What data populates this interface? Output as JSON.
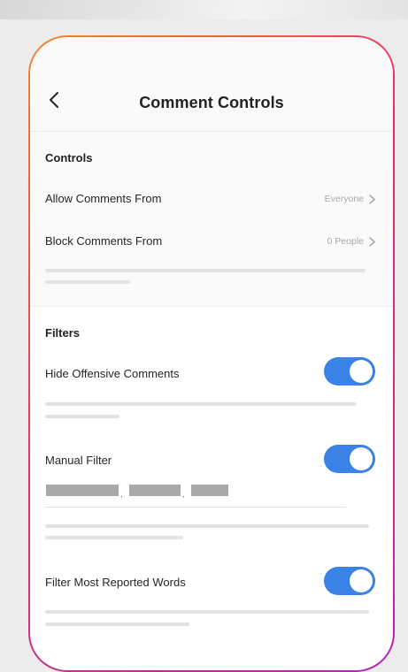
{
  "header": {
    "title": "Comment Controls",
    "back_icon": "chevron-left-icon"
  },
  "controls": {
    "section_title": "Controls",
    "rows": [
      {
        "label": "Allow Comments From",
        "value": "Everyone"
      },
      {
        "label": "Block Comments From",
        "value": "0 People"
      }
    ]
  },
  "filters": {
    "section_title": "Filters",
    "items": [
      {
        "label": "Hide Offensive Comments",
        "enabled": true
      },
      {
        "label": "Manual Filter",
        "enabled": true
      },
      {
        "label": "Filter Most Reported Words",
        "enabled": true
      }
    ],
    "manual_filter_separator": ","
  },
  "colors": {
    "toggle_on": "#3b82e6",
    "border_gradient_start": "#f58529",
    "border_gradient_end": "#b326b7"
  }
}
